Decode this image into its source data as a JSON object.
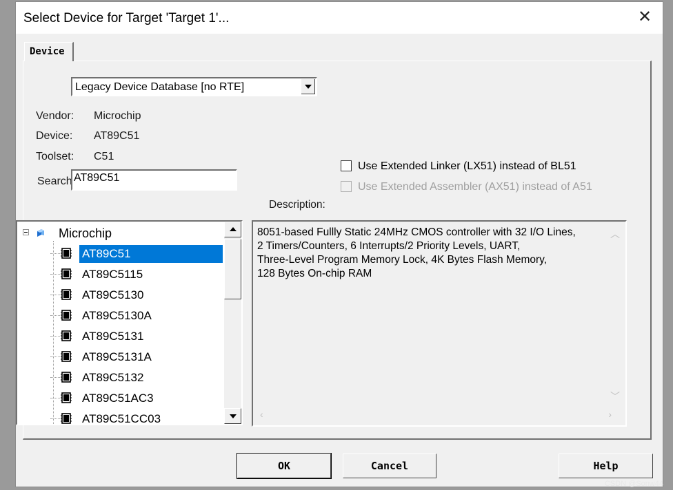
{
  "window": {
    "title": "Select Device for Target 'Target 1'..."
  },
  "tab": {
    "label": "Device"
  },
  "database_select": {
    "value": "Legacy Device Database [no RTE]"
  },
  "info": {
    "vendor_label": "Vendor:",
    "vendor_value": "Microchip",
    "device_label": "Device:",
    "device_value": "AT89C51",
    "toolset_label": "Toolset:",
    "toolset_value": "C51",
    "search_label": "Search:",
    "search_value": "AT89C51"
  },
  "options": {
    "lx51_label": "Use Extended Linker (LX51) instead of BL51",
    "ax51_label": "Use Extended Assembler (AX51) instead of A51"
  },
  "description": {
    "label": "Description:",
    "text": "8051-based Fullly Static 24MHz CMOS controller with 32  I/O Lines,\n2 Timers/Counters, 6 Interrupts/2 Priority Levels, UART,\nThree-Level Program Memory Lock, 4K Bytes Flash Memory,\n128 Bytes On-chip RAM"
  },
  "tree": {
    "root": "Microchip",
    "items": [
      "AT89C51",
      "AT89C5115",
      "AT89C5130",
      "AT89C5130A",
      "AT89C5131",
      "AT89C5131A",
      "AT89C5132",
      "AT89C51AC3",
      "AT89C51CC03"
    ],
    "selected_index": 0
  },
  "buttons": {
    "ok": "OK",
    "cancel": "Cancel",
    "help": "Help"
  },
  "watermark": "CSDN @Sonw44",
  "colors": {
    "selection": "#0078d7",
    "dialog_bg": "#f0f0f0"
  }
}
